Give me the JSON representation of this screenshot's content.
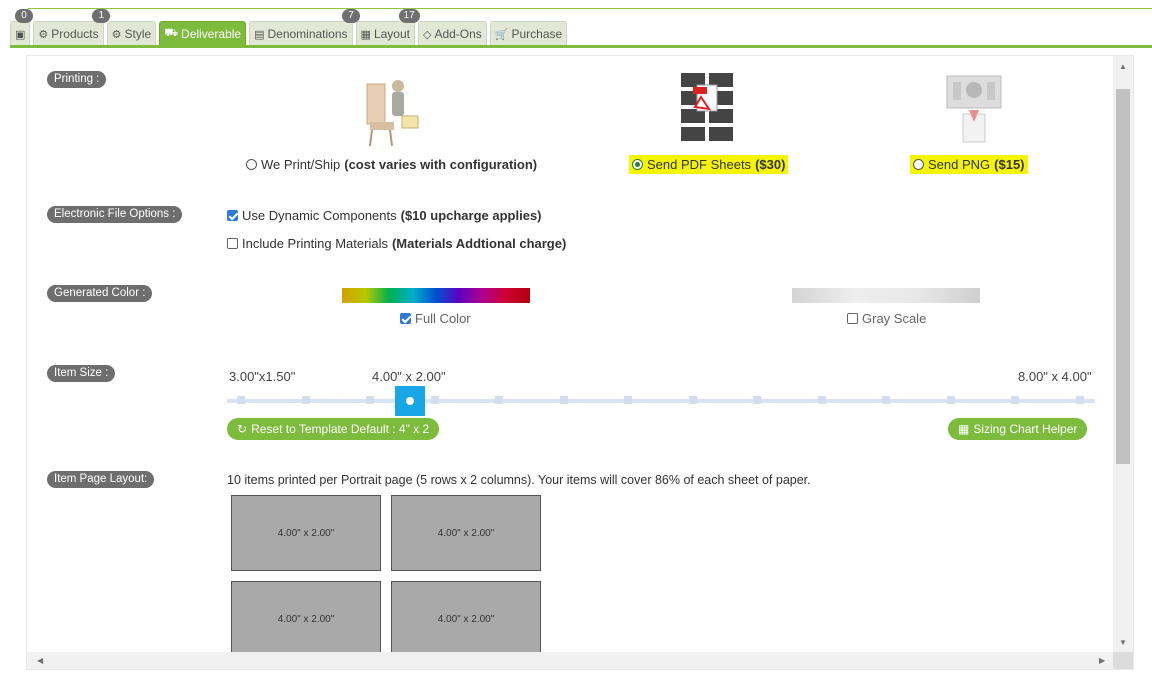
{
  "tabs": [
    {
      "label": "",
      "icon": "image-icon",
      "badge": "0"
    },
    {
      "label": "Products",
      "icon": "gear-icon",
      "badge": "1"
    },
    {
      "label": "Style",
      "icon": "gears-icon",
      "badge": ""
    },
    {
      "label": "Deliverable",
      "icon": "truck-icon",
      "badge": "",
      "active": true
    },
    {
      "label": "Denominations",
      "icon": "money-icon",
      "badge": "7"
    },
    {
      "label": "Layout",
      "icon": "layout-icon",
      "badge": "17"
    },
    {
      "label": "Add-Ons",
      "icon": "diamond-icon",
      "badge": ""
    },
    {
      "label": "Purchase",
      "icon": "cart-icon",
      "badge": ""
    }
  ],
  "sections": {
    "printing": "Printing :",
    "electronic": "Electronic File Options :",
    "color": "Generated Color :",
    "size": "Item Size :",
    "layout": "Item Page Layout:"
  },
  "printing": {
    "we_print_label": "We Print/Ship",
    "we_print_note": "(cost varies with configuration)",
    "pdf_label": "Send PDF Sheets",
    "pdf_price": "($30)",
    "png_label": "Send PNG",
    "png_price": "($15)",
    "selected": "pdf"
  },
  "electronic": {
    "dynamic_label": "Use Dynamic Components",
    "dynamic_note": "($10 upcharge applies)",
    "dynamic_checked": true,
    "printing_label": "Include Printing Materials",
    "printing_note": "(Materials Addtional charge)",
    "printing_checked": false
  },
  "color": {
    "full_label": "Full Color",
    "full_checked": true,
    "gray_label": "Gray Scale",
    "gray_checked": false
  },
  "size": {
    "min_label": "3.00\"x1.50\"",
    "current_label": "4.00\" x 2.00\"",
    "max_label": "8.00\" x 4.00\"",
    "reset_label": "Reset to Template Default : 4\" x 2",
    "helper_label": "Sizing Chart Helper"
  },
  "layout": {
    "summary": "10 items printed per Portrait page (5 rows x 2 columns). Your items will cover 86% of each sheet of paper.",
    "cell_label": "4.00\" x 2.00\""
  },
  "colors": {
    "accent": "#7dbb3c",
    "slider_handle": "#19a6e6",
    "highlight": "#f5f500",
    "label_bg": "#6e6e6e"
  }
}
